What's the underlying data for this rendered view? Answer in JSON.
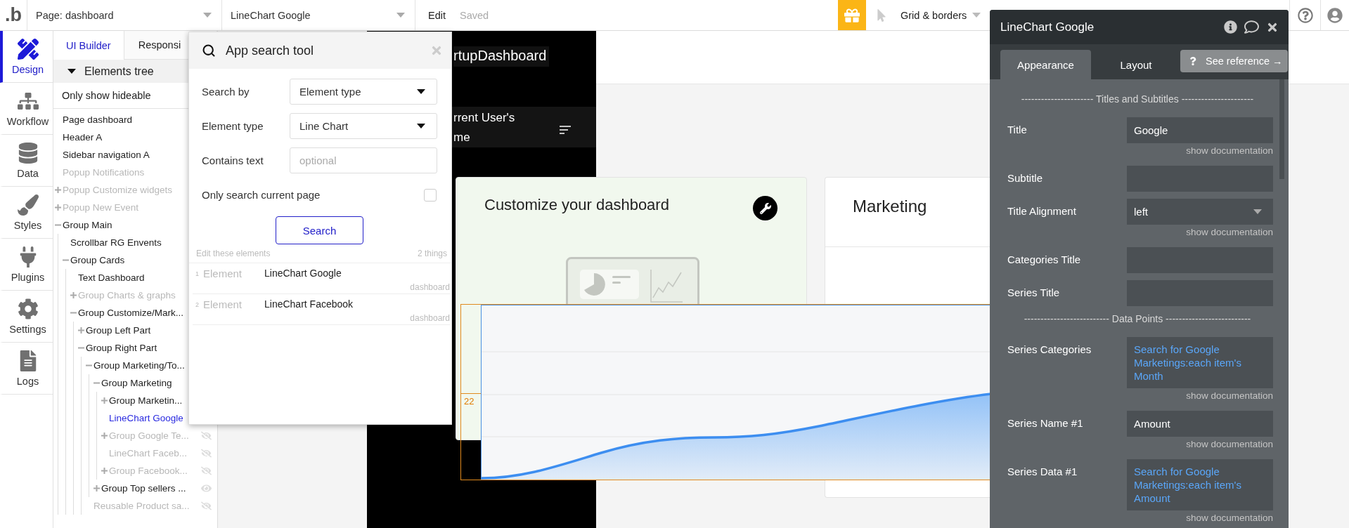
{
  "logo": ".b",
  "top_bar": {
    "page_dropdown": "Page: dashboard",
    "element_dropdown": "LineChart Google",
    "edit": "Edit",
    "status": "Saved",
    "grid_menu": "Grid & borders"
  },
  "nav": [
    {
      "label": "Design",
      "selected": true
    },
    {
      "label": "Workflow",
      "selected": false
    },
    {
      "label": "Data",
      "selected": false
    },
    {
      "label": "Styles",
      "selected": false
    },
    {
      "label": "Plugins",
      "selected": false
    },
    {
      "label": "Settings",
      "selected": false
    },
    {
      "label": "Logs",
      "selected": false
    }
  ],
  "tree_tabs": [
    {
      "label": "UI Builder",
      "selected": true
    },
    {
      "label": "Responsi",
      "selected": false
    }
  ],
  "tree_header": "Elements tree",
  "hideable_filter": "Only show hideable",
  "tree": [
    {
      "label": "Page dashboard",
      "dimmed": false,
      "selected": false
    },
    {
      "label": "Header A",
      "dimmed": false,
      "selected": false
    },
    {
      "label": "Sidebar navigation A",
      "dimmed": false,
      "selected": false
    },
    {
      "label": "Popup Notifications",
      "dimmed": true,
      "selected": false
    },
    {
      "label": "Popup Customize widgets",
      "dimmed": true,
      "selected": false,
      "expanded": false
    },
    {
      "label": "Popup New Event",
      "dimmed": true,
      "selected": false,
      "expanded": false
    },
    {
      "label": "Group Main",
      "dimmed": false,
      "selected": false,
      "expanded": true,
      "children": [
        {
          "label": "Scrollbar RG Envents",
          "dimmed": false,
          "selected": false
        },
        {
          "label": "Group Cards",
          "dimmed": false,
          "selected": false,
          "expanded": true,
          "children": [
            {
              "label": "Text Dashboard",
              "dimmed": false,
              "selected": false
            },
            {
              "label": "Group Charts & graphs",
              "dimmed": true,
              "selected": false,
              "expanded": false
            },
            {
              "label": "Group Customize/Mark...",
              "dimmed": false,
              "selected": false,
              "expanded": true,
              "children": [
                {
                  "label": "Group Left Part",
                  "dimmed": false,
                  "selected": false,
                  "expanded": false
                },
                {
                  "label": "Group Right Part",
                  "dimmed": false,
                  "selected": false,
                  "expanded": true,
                  "children": [
                    {
                      "label": "Group Marketing/To...",
                      "dimmed": false,
                      "selected": false,
                      "expanded": true,
                      "children": [
                        {
                          "label": "Group Marketing",
                          "dimmed": false,
                          "selected": false,
                          "expanded": true,
                          "children": [
                            {
                              "label": "Group Marketin...",
                              "dimmed": false,
                              "selected": false,
                              "expanded": false
                            },
                            {
                              "label": "LineChart Google",
                              "dimmed": false,
                              "selected": true
                            },
                            {
                              "label": "Group Google Te...",
                              "dimmed": true,
                              "selected": false,
                              "expanded": false,
                              "eye_open": false
                            },
                            {
                              "label": "LineChart Faceb...",
                              "dimmed": true,
                              "selected": false,
                              "eye_open": false
                            },
                            {
                              "label": "Group Facebook...",
                              "dimmed": true,
                              "selected": false,
                              "expanded": false,
                              "eye_open": false
                            }
                          ]
                        },
                        {
                          "label": "Group Top sellers ...",
                          "dimmed": false,
                          "selected": false,
                          "expanded": false,
                          "eye_open": true
                        }
                      ]
                    },
                    {
                      "label": "Reusable Product sa...",
                      "dimmed": true,
                      "selected": false,
                      "eye_open": false
                    }
                  ]
                }
              ]
            }
          ]
        }
      ]
    }
  ],
  "search_tool": {
    "title": "App search tool",
    "fields": [
      {
        "label": "Search by",
        "kind": "select",
        "value": "Element type"
      },
      {
        "label": "Element type",
        "kind": "select",
        "value": "Line Chart"
      },
      {
        "label": "Contains text",
        "kind": "text",
        "placeholder": "optional"
      },
      {
        "label": "Only search current page",
        "kind": "checkbox",
        "checked": false
      }
    ],
    "button": "Search",
    "results_caption": "Edit these elements",
    "results_count": "2 things",
    "results": [
      {
        "index": "1",
        "type": "Element",
        "name": "LineChart Google",
        "page": "dashboard"
      },
      {
        "index": "2",
        "type": "Element",
        "name": "LineChart Facebook",
        "page": "dashboard"
      }
    ]
  },
  "canvas": {
    "brand": "rtupDashboard",
    "user_lines": [
      "rrent User's",
      "me"
    ],
    "customize_card": {
      "title": "Customize your dashboard"
    },
    "marketing_card": {
      "title": "Marketing"
    },
    "chart": {
      "value_label": "22"
    }
  },
  "property_editor": {
    "title": "LineChart Google",
    "tabs": [
      {
        "label": "Appearance",
        "selected": true
      },
      {
        "label": "Layout",
        "selected": false
      }
    ],
    "reference_button": "See reference →",
    "rows": [
      {
        "kind": "divider",
        "text": "---------------------- Titles and Subtitles ----------------------"
      },
      {
        "kind": "text",
        "label": "Title",
        "value": "Google",
        "doc": "show documentation"
      },
      {
        "kind": "text",
        "label": "Subtitle"
      },
      {
        "kind": "select",
        "label": "Title Alignment",
        "value": "left",
        "doc": "show documentation"
      },
      {
        "kind": "text",
        "label": "Categories Title"
      },
      {
        "kind": "text",
        "label": "Series Title"
      },
      {
        "kind": "divider",
        "text": "-------------------------- Data Points --------------------------"
      },
      {
        "kind": "dynamic",
        "label": "Series Categories",
        "value": "Search for Google Marketings:each item's Month",
        "doc": "show documentation"
      },
      {
        "kind": "text",
        "label": "Series Name #1",
        "value": "Amount",
        "doc": "show documentation"
      },
      {
        "kind": "dynamic",
        "label": "Series Data #1",
        "value": "Search for Google Marketings:each item's Amount",
        "doc": "show documentation"
      }
    ]
  }
}
